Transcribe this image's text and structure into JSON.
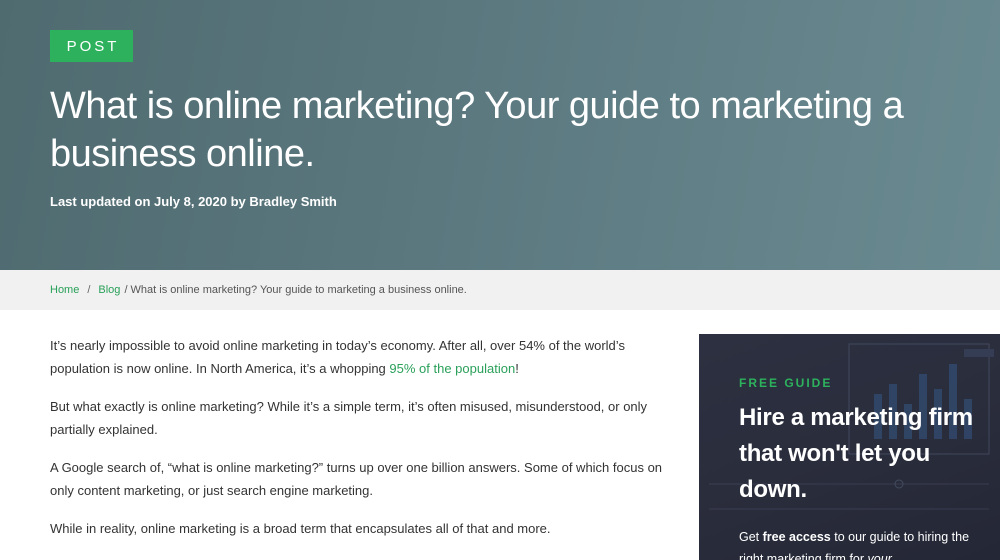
{
  "hero": {
    "badge": "POST",
    "title": "What is online marketing? Your guide to marketing a business online.",
    "meta": "Last updated on July 8, 2020 by Bradley Smith"
  },
  "breadcrumb": {
    "home": "Home",
    "sep1": "/",
    "blog": "Blog",
    "current": "/ What is online marketing? Your guide to marketing a business online."
  },
  "article": {
    "p1_pre": "It’s nearly impossible to avoid online marketing in today’s economy. After all, over 54% of the world’s population is now online. In North America, it’s a whopping ",
    "p1_link": "95% of the population",
    "p1_post": "!",
    "p2": "But what exactly is online marketing? While it’s a simple term, it’s often misused, misunderstood, or only partially explained.",
    "p3": "A Google search of, “what is online marketing?” turns up over one billion answers. Some of which focus on only content marketing, or just search engine marketing.",
    "p4": "While in reality, online marketing is a broad term that encapsulates all of that and more."
  },
  "promo": {
    "label": "FREE GUIDE",
    "title": "Hire a marketing firm that won't let you down.",
    "text_pre": "Get ",
    "text_bold": "free access",
    "text_mid": " to our guide to hiring the right marketing firm for ",
    "text_italic": "your"
  },
  "colors": {
    "accent": "#2db15d",
    "link": "#2aa05a",
    "hero_bg": "#5b787f",
    "promo_bg": "#2a2d3c"
  }
}
